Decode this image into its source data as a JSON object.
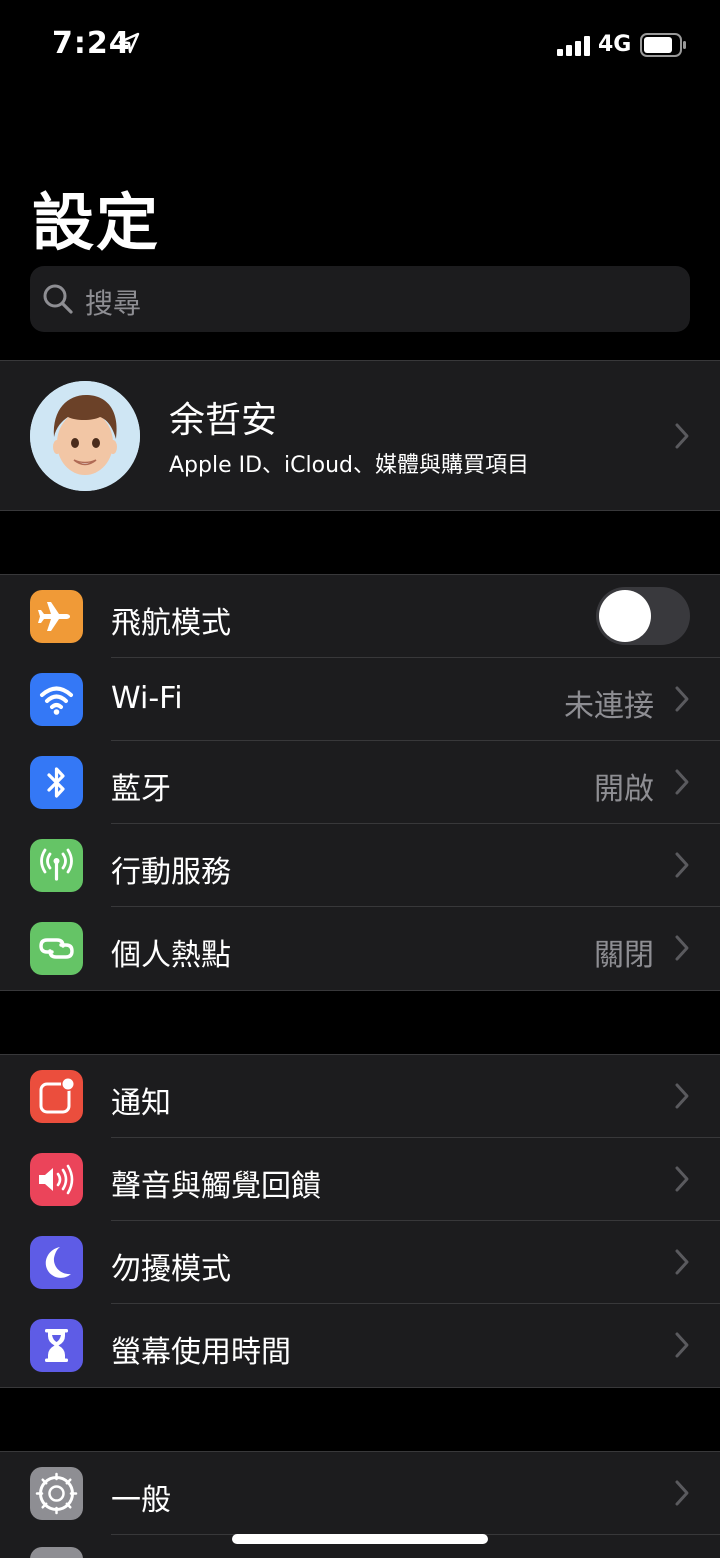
{
  "status_bar": {
    "time": "7:24",
    "network": "4G"
  },
  "title": "設定",
  "search": {
    "placeholder": "搜尋"
  },
  "profile": {
    "name": "余哲安",
    "subtitle": "Apple ID、iCloud、媒體與購買項目"
  },
  "groups": [
    {
      "rows": [
        {
          "label": "飛航模式",
          "icon": "airplane-icon",
          "color": "#f09a37",
          "toggle": false
        },
        {
          "label": "Wi-Fi",
          "value": "未連接",
          "icon": "wifi-icon",
          "color": "#3478f6"
        },
        {
          "label": "藍牙",
          "value": "開啟",
          "icon": "bluetooth-icon",
          "color": "#3478f6"
        },
        {
          "label": "行動服務",
          "value": "",
          "icon": "antenna-icon",
          "color": "#65c466"
        },
        {
          "label": "個人熱點",
          "value": "關閉",
          "icon": "hotspot-icon",
          "color": "#65c466"
        }
      ]
    },
    {
      "rows": [
        {
          "label": "通知",
          "icon": "notification-icon",
          "color": "#eb4e3d"
        },
        {
          "label": "聲音與觸覺回饋",
          "icon": "speaker-icon",
          "color": "#eb445a"
        },
        {
          "label": "勿擾模式",
          "icon": "moon-icon",
          "color": "#5e5ce6"
        },
        {
          "label": "螢幕使用時間",
          "icon": "hourglass-icon",
          "color": "#5e5ce6"
        }
      ]
    },
    {
      "rows": [
        {
          "label": "一般",
          "icon": "gear-icon",
          "color": "#8e8e93"
        }
      ]
    }
  ]
}
